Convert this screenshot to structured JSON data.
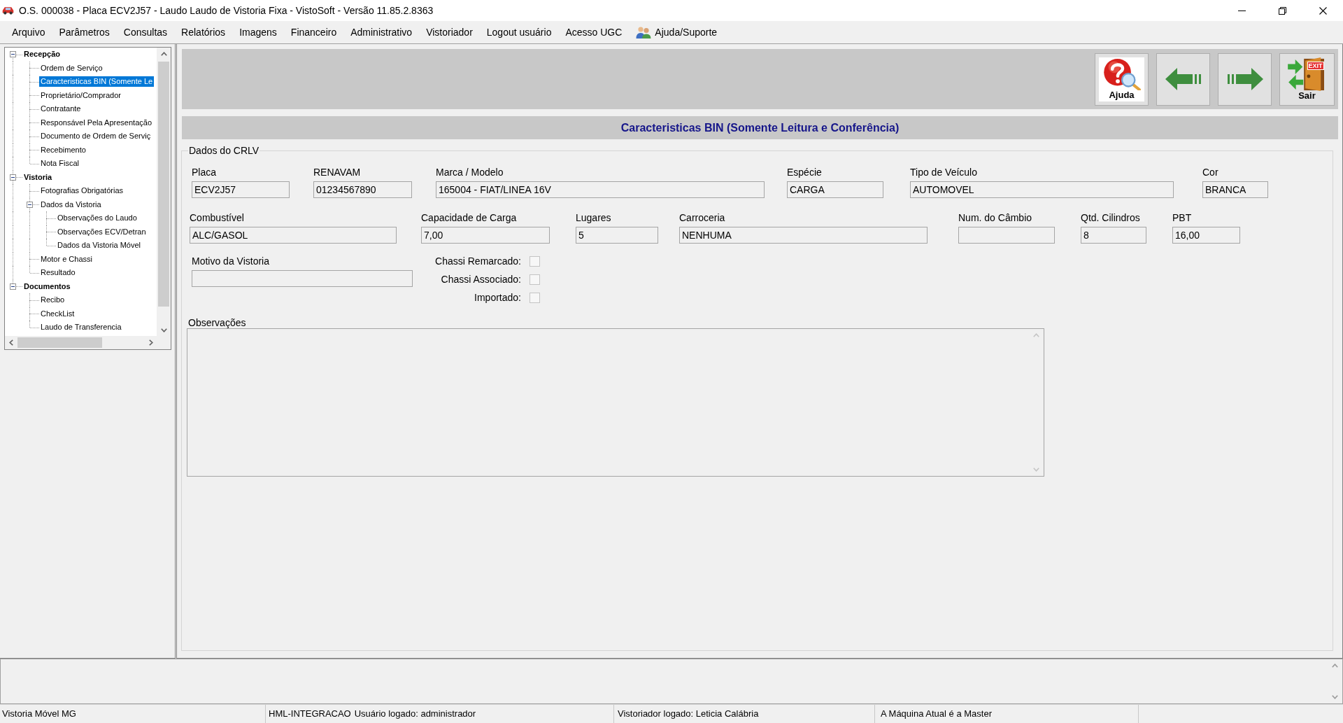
{
  "window": {
    "title": "O.S. 000038 - Placa ECV2J57 - Laudo Laudo de Vistoria Fixa - VistoSoft - Versão 11.85.2.8363"
  },
  "menu": [
    {
      "label": "Arquivo",
      "kind": "plain"
    },
    {
      "label": "Parâmetros",
      "kind": "plain"
    },
    {
      "label": "Consultas",
      "kind": "plain"
    },
    {
      "label": "Relatórios",
      "kind": "plain"
    },
    {
      "label": "Imagens",
      "kind": "plain"
    },
    {
      "label": "Financeiro",
      "kind": "plain"
    },
    {
      "label": "Administrativo",
      "kind": "plain"
    },
    {
      "label": "Vistoriador",
      "kind": "plain"
    },
    {
      "label": "Logout usuário",
      "kind": "plain"
    },
    {
      "label": "Acesso UGC",
      "kind": "plain"
    },
    {
      "label": "Ajuda/Suporte",
      "kind": "icon"
    }
  ],
  "sidebar": {
    "tree": [
      {
        "label": "Recepção",
        "expanded": true,
        "selected": false,
        "children": [
          {
            "label": "Ordem de Serviço",
            "selected": false
          },
          {
            "label": "Caracteristicas BIN (Somente Le",
            "selected": true
          },
          {
            "label": "Proprietário/Comprador",
            "selected": false
          },
          {
            "label": "Contratante",
            "selected": false
          },
          {
            "label": "Responsável Pela Apresentação",
            "selected": false
          },
          {
            "label": "Documento de Ordem de Serviç",
            "selected": false
          },
          {
            "label": "Recebimento",
            "selected": false
          },
          {
            "label": "Nota Fiscal",
            "selected": false
          }
        ]
      },
      {
        "label": "Vistoria",
        "expanded": true,
        "selected": false,
        "children": [
          {
            "label": "Fotografias Obrigatórias",
            "selected": false
          },
          {
            "label": "Dados da Vistoria",
            "expanded": true,
            "selected": false,
            "children": [
              {
                "label": "Observações do Laudo",
                "selected": false
              },
              {
                "label": "Observações ECV/Detran",
                "selected": false
              },
              {
                "label": "Dados da Vistoria Móvel",
                "selected": false
              }
            ]
          },
          {
            "label": "Motor e Chassi",
            "selected": false
          },
          {
            "label": "Resultado",
            "selected": false
          }
        ]
      },
      {
        "label": "Documentos",
        "expanded": true,
        "selected": false,
        "children": [
          {
            "label": "Recibo",
            "selected": false
          },
          {
            "label": "CheckList",
            "selected": false
          },
          {
            "label": "Laudo de Transferencia",
            "selected": false
          }
        ]
      }
    ]
  },
  "toolbar": {
    "buttons": [
      {
        "kind": "help",
        "label": "Ajuda"
      },
      {
        "kind": "back"
      },
      {
        "kind": "forward"
      },
      {
        "kind": "exit",
        "label": "Sair",
        "sign": "EXIT"
      }
    ]
  },
  "form": {
    "title": "Caracteristicas BIN (Somente Leitura e Conferência)",
    "group": "Dados do CRLV",
    "fields": [
      {
        "label": "Placa",
        "value": "ECV2J57"
      },
      {
        "label": "RENAVAM",
        "value": "01234567890"
      },
      {
        "label": "Marca / Modelo",
        "value": "165004 - FIAT/LINEA 16V"
      },
      {
        "label": "Espécie",
        "value": "CARGA"
      },
      {
        "label": "Tipo de Veículo",
        "value": "AUTOMOVEL"
      },
      {
        "label": "Cor",
        "value": "BRANCA"
      },
      {
        "label": "Combustível",
        "value": "ALC/GASOL"
      },
      {
        "label": "Capacidade de Carga",
        "value": "7,00"
      },
      {
        "label": "Lugares",
        "value": "5"
      },
      {
        "label": "Carroceria",
        "value": "NENHUMA"
      },
      {
        "label": "Num. do Câmbio"
      },
      {
        "label": "Qtd. Cilindros",
        "value": "8"
      },
      {
        "label": "PBT",
        "value": "16,00"
      },
      {
        "label": "Motivo da Vistoria"
      }
    ],
    "checkboxes": [
      {
        "label": "Chassi Remarcado:",
        "checked": false
      },
      {
        "label": "Chassi Associado:",
        "checked": false
      },
      {
        "label": "Importado:",
        "checked": false
      }
    ],
    "notes": {
      "label": "Observações"
    }
  },
  "status_bar": {
    "panels": [
      [
        "Vistoria Móvel MG"
      ],
      [
        "HML-INTEGRACAO",
        "Usuário logado: administrador"
      ],
      [
        "Vistoriador logado: Leticia Calábria"
      ],
      [
        "A Máquina Atual é a Master"
      ]
    ]
  }
}
